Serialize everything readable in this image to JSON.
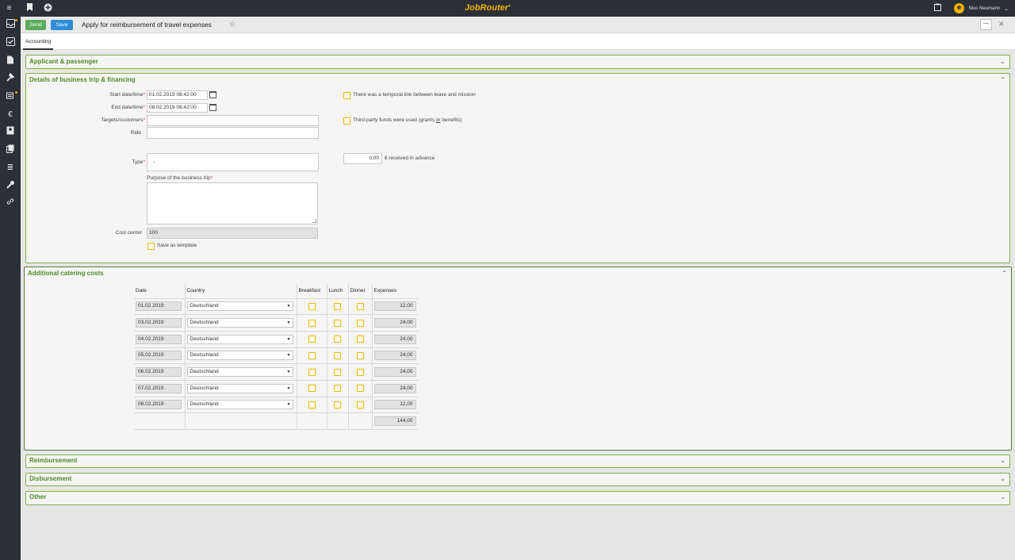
{
  "app": {
    "brand": "JobRouter",
    "user_name": "Nico Neumann"
  },
  "header": {
    "send_label": "Send",
    "save_label": "Save",
    "title": "Apply for reimbursement of travel expenses"
  },
  "tabs": [
    {
      "label": "Accounting"
    }
  ],
  "sections": {
    "applicant": "Applicant & passenger",
    "details": "Details of business trip & financing",
    "catering": "Additional catering costs",
    "reimbursement": "Reimbursement",
    "disbursement": "Disbursement",
    "other": "Other"
  },
  "details": {
    "start_label": "Start date/time",
    "start_value": "01.02.2019 08:42:00",
    "end_label": "End date/time",
    "end_value": "08.02.2019 08:42:00",
    "targets_label": "Targets/customers",
    "ride_label": "Ride",
    "type_label": "Type",
    "type_value": "-",
    "purpose_label": "Purpose of the business trip",
    "cost_center_label": "Cost center",
    "cost_center_value": "100",
    "save_template_label": "Save as template",
    "temporal_link_label": "There was a temporal link between leave and mission",
    "third_party_label_pre": "Third-party funds were used (grants ",
    "third_party_label_or": "or",
    "third_party_label_post": " benefits)",
    "advance_value": "0,00",
    "advance_label": "€ received in advance",
    "required_mark": "*"
  },
  "catering": {
    "headers": [
      "Date",
      "Country",
      "Breakfast",
      "Lunch",
      "Dinner",
      "Expenses"
    ],
    "rows": [
      {
        "date": "01.02.2019",
        "country": "Deutschland",
        "expenses": "12,00"
      },
      {
        "date": "03.02.2019",
        "country": "Deutschland",
        "expenses": "24,00"
      },
      {
        "date": "04.02.2019",
        "country": "Deutschland",
        "expenses": "24,00"
      },
      {
        "date": "05.02.2019",
        "country": "Deutschland",
        "expenses": "24,00"
      },
      {
        "date": "06.02.2019",
        "country": "Deutschland",
        "expenses": "24,00"
      },
      {
        "date": "07.02.2019",
        "country": "Deutschland",
        "expenses": "24,00"
      },
      {
        "date": "08.02.2019",
        "country": "Deutschland",
        "expenses": "12,00"
      }
    ],
    "total": "144,00"
  },
  "colors": {
    "accent_green": "#7cb342",
    "title_green": "#4e8a23",
    "send_green": "#5cad5c",
    "save_blue": "#2e8fd6",
    "checkbox_yellow": "#f0b400",
    "sidebar_dark": "#2b2f36"
  }
}
